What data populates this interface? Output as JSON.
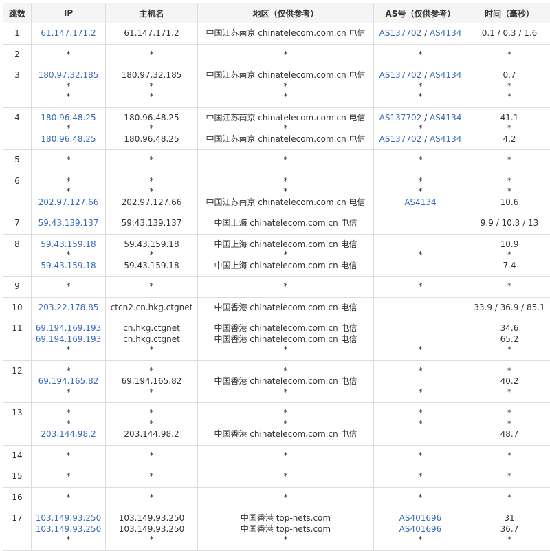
{
  "headers": {
    "hop": "跳数",
    "ip": "IP",
    "host": "主机名",
    "region": "地区（仅供参考）",
    "as": "AS号（仅供参考）",
    "time": "时间（毫秒）"
  },
  "colors": {
    "link": "#3a6bb8",
    "border": "#dddddd",
    "header_bg": "#f5f5f5",
    "text": "#333333"
  },
  "rows": [
    {
      "hop": "1",
      "lines": [
        {
          "ip": "61.147.171.2",
          "host": "61.147.171.2",
          "region": "中国江苏南京 chinatelecom.com.cn 电信",
          "as": [
            "AS137702",
            "AS4134"
          ],
          "time": "0.1 / 0.3 / 1.6"
        }
      ]
    },
    {
      "hop": "2",
      "lines": [
        {
          "ip": "*",
          "host": "*",
          "region": "*",
          "as": [
            "*"
          ],
          "time": "*"
        }
      ]
    },
    {
      "hop": "3",
      "lines": [
        {
          "ip": "180.97.32.185",
          "host": "180.97.32.185",
          "region": "中国江苏南京 chinatelecom.com.cn 电信",
          "as": [
            "AS137702",
            "AS4134"
          ],
          "time": "0.7"
        },
        {
          "ip": "*",
          "host": "*",
          "region": "*",
          "as": [
            "*"
          ],
          "time": "*"
        },
        {
          "ip": "*",
          "host": "*",
          "region": "*",
          "as": [
            "*"
          ],
          "time": "*"
        }
      ]
    },
    {
      "hop": "4",
      "lines": [
        {
          "ip": "180.96.48.25",
          "host": "180.96.48.25",
          "region": "中国江苏南京 chinatelecom.com.cn 电信",
          "as": [
            "AS137702",
            "AS4134"
          ],
          "time": "41.1"
        },
        {
          "ip": "*",
          "host": "*",
          "region": "*",
          "as": [
            "*"
          ],
          "time": "*"
        },
        {
          "ip": "180.96.48.25",
          "host": "180.96.48.25",
          "region": "中国江苏南京 chinatelecom.com.cn 电信",
          "as": [
            "AS137702",
            "AS4134"
          ],
          "time": "4.2"
        }
      ]
    },
    {
      "hop": "5",
      "lines": [
        {
          "ip": "*",
          "host": "*",
          "region": "*",
          "as": [
            "*"
          ],
          "time": "*"
        }
      ]
    },
    {
      "hop": "6",
      "lines": [
        {
          "ip": "*",
          "host": "*",
          "region": "*",
          "as": [
            "*"
          ],
          "time": "*"
        },
        {
          "ip": "*",
          "host": "*",
          "region": "*",
          "as": [
            "*"
          ],
          "time": "*"
        },
        {
          "ip": "202.97.127.66",
          "host": "202.97.127.66",
          "region": "中国江苏南京 chinatelecom.com.cn 电信",
          "as": [
            "AS4134"
          ],
          "time": "10.6"
        }
      ]
    },
    {
      "hop": "7",
      "lines": [
        {
          "ip": "59.43.139.137",
          "host": "59.43.139.137",
          "region": "中国上海 chinatelecom.com.cn 电信",
          "as": [],
          "time": "9.9 / 10.3 / 13"
        }
      ]
    },
    {
      "hop": "8",
      "lines": [
        {
          "ip": "59.43.159.18",
          "host": "59.43.159.18",
          "region": "中国上海 chinatelecom.com.cn 电信",
          "as": [],
          "time": "10.9"
        },
        {
          "ip": "*",
          "host": "*",
          "region": "*",
          "as": [
            "*"
          ],
          "time": "*"
        },
        {
          "ip": "59.43.159.18",
          "host": "59.43.159.18",
          "region": "中国上海 chinatelecom.com.cn 电信",
          "as": [],
          "time": "7.4"
        }
      ]
    },
    {
      "hop": "9",
      "lines": [
        {
          "ip": "*",
          "host": "*",
          "region": "*",
          "as": [
            "*"
          ],
          "time": "*"
        }
      ]
    },
    {
      "hop": "10",
      "lines": [
        {
          "ip": "203.22.178.85",
          "host": "ctcn2.cn.hkg.ctgnet",
          "region": "中国香港 chinatelecom.com.cn 电信",
          "as": [],
          "time": "33.9 / 36.9 / 85.1"
        }
      ]
    },
    {
      "hop": "11",
      "lines": [
        {
          "ip": "69.194.169.193",
          "host": "cn.hkg.ctgnet",
          "region": "中国香港 chinatelecom.com.cn 电信",
          "as": [],
          "time": "34.6"
        },
        {
          "ip": "69.194.169.193",
          "host": "cn.hkg.ctgnet",
          "region": "中国香港 chinatelecom.com.cn 电信",
          "as": [],
          "time": "65.2"
        },
        {
          "ip": "*",
          "host": "*",
          "region": "*",
          "as": [
            "*"
          ],
          "time": "*"
        }
      ]
    },
    {
      "hop": "12",
      "lines": [
        {
          "ip": "*",
          "host": "*",
          "region": "*",
          "as": [
            "*"
          ],
          "time": "*"
        },
        {
          "ip": "69.194.165.82",
          "host": "69.194.165.82",
          "region": "中国香港 chinatelecom.com.cn 电信",
          "as": [],
          "time": "40.2"
        },
        {
          "ip": "*",
          "host": "*",
          "region": "*",
          "as": [
            "*"
          ],
          "time": "*"
        }
      ]
    },
    {
      "hop": "13",
      "lines": [
        {
          "ip": "*",
          "host": "*",
          "region": "*",
          "as": [
            "*"
          ],
          "time": "*"
        },
        {
          "ip": "*",
          "host": "*",
          "region": "*",
          "as": [
            "*"
          ],
          "time": "*"
        },
        {
          "ip": "203.144.98.2",
          "host": "203.144.98.2",
          "region": "中国香港 chinatelecom.com.cn 电信",
          "as": [],
          "time": "48.7"
        }
      ]
    },
    {
      "hop": "14",
      "lines": [
        {
          "ip": "*",
          "host": "*",
          "region": "*",
          "as": [
            "*"
          ],
          "time": "*"
        }
      ]
    },
    {
      "hop": "15",
      "lines": [
        {
          "ip": "*",
          "host": "*",
          "region": "*",
          "as": [
            "*"
          ],
          "time": "*"
        }
      ]
    },
    {
      "hop": "16",
      "lines": [
        {
          "ip": "*",
          "host": "*",
          "region": "*",
          "as": [
            "*"
          ],
          "time": "*"
        }
      ]
    },
    {
      "hop": "17",
      "lines": [
        {
          "ip": "103.149.93.250",
          "host": "103.149.93.250",
          "region": "中国香港 top-nets.com",
          "as": [
            "AS401696"
          ],
          "time": "31"
        },
        {
          "ip": "103.149.93.250",
          "host": "103.149.93.250",
          "region": "中国香港 top-nets.com",
          "as": [
            "AS401696"
          ],
          "time": "36.7"
        },
        {
          "ip": "*",
          "host": "*",
          "region": "*",
          "as": [
            "*"
          ],
          "time": "*"
        }
      ]
    }
  ]
}
